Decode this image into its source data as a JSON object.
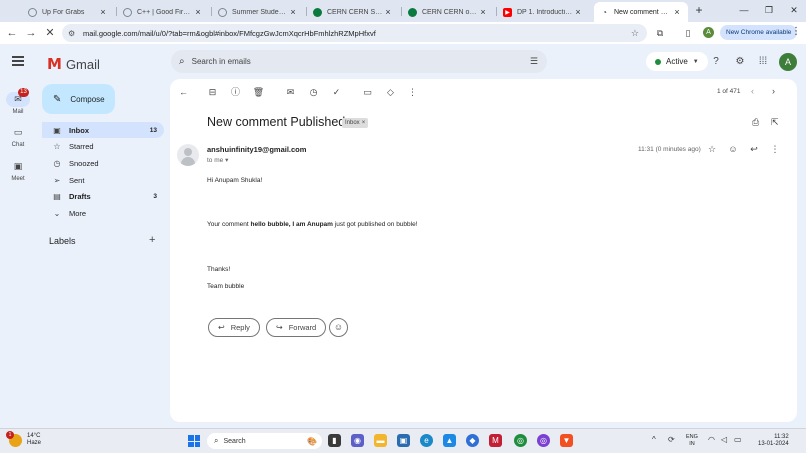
{
  "browser": {
    "tabs": [
      {
        "title": "Up For Grabs",
        "icon": "globe-icon",
        "color": "#7b8794"
      },
      {
        "title": "C++ | Good First Issues",
        "icon": "globe-icon",
        "color": "#7b8794"
      },
      {
        "title": "Summer Student Opportunity",
        "icon": "globe-icon",
        "color": "#7b8794"
      },
      {
        "title": "CERN CERN Summer Student",
        "icon": "cern-icon",
        "color": "#0b7a3e"
      },
      {
        "title": "CERN CERN openlab",
        "icon": "cern-icon",
        "color": "#0b7a3e"
      },
      {
        "title": "DP 1. Introduction to DP",
        "icon": "youtube-icon",
        "color": "#ff0000"
      },
      {
        "title": "New comment Published",
        "icon": "gmail-icon",
        "color": "#d93025",
        "active": true
      }
    ],
    "address": "mail.google.com/mail/u/0/?tab=rm&ogbl#inbox/FMfcgzGwJcmXqcrHbFmhlzhRZMpHfxvf",
    "update_label": "New Chrome available",
    "profile_initial": "A"
  },
  "gmail": {
    "brand": "Gmail",
    "search_placeholder": "Search in emails",
    "status": "Active",
    "avatar_initial": "A",
    "rail": [
      {
        "label": "Mail",
        "badge": "13"
      },
      {
        "label": "Chat"
      },
      {
        "label": "Meet"
      }
    ],
    "compose_label": "Compose",
    "nav": [
      {
        "label": "Inbox",
        "count": "13"
      },
      {
        "label": "Starred",
        "count": ""
      },
      {
        "label": "Snoozed",
        "count": ""
      },
      {
        "label": "Sent",
        "count": ""
      },
      {
        "label": "Drafts",
        "count": "3"
      },
      {
        "label": "More",
        "count": ""
      }
    ],
    "labels_title": "Labels"
  },
  "message": {
    "pager": "1 of 471",
    "subject": "New comment Published",
    "label_chip": "Inbox",
    "sender": "anshuinfinity19@gmail.com",
    "to_line": "to me",
    "time": "11:31 (0 minutes ago)",
    "greeting": "Hi Anupam Shukla!",
    "body_prefix": "Your comment ",
    "body_bold": "hello bubble, I am Anupam",
    "body_suffix": " just got published on bubble!",
    "thanks": "Thanks!",
    "signoff": "Team bubble",
    "reply_label": "Reply",
    "forward_label": "Forward"
  },
  "taskbar": {
    "temp": "14°C",
    "weather": "Haze",
    "weather_badge": "1",
    "search_label": "Search",
    "lang_top": "ENG",
    "lang_bottom": "IN",
    "time": "11:32",
    "date": "13-01-2024"
  }
}
